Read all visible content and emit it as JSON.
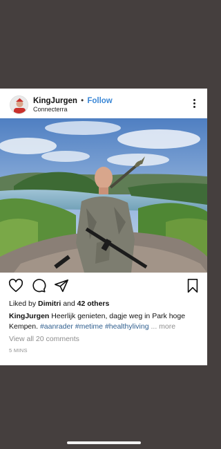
{
  "post": {
    "username": "KingJurgen",
    "separator": "•",
    "follow_label": "Follow",
    "location": "Connecterra",
    "liked_by_prefix": "Liked by",
    "liked_by_user": "Dimitri",
    "liked_by_and": "and",
    "liked_by_others": "42 others",
    "caption_user": "KingJurgen",
    "caption_text": "Heerlijk genieten, dagje weg in Park hoge Kempen.",
    "hashtags": [
      "#aanrader",
      "#metime",
      "#healthyliving"
    ],
    "more_label": "... more",
    "comments_label": "View all 20 comments",
    "timestamp": "5 MINS"
  },
  "icons": {
    "more": "more-options-icon",
    "like": "heart-icon",
    "comment": "comment-icon",
    "share": "send-icon",
    "save": "bookmark-icon"
  },
  "colors": {
    "background": "#453f3e",
    "card": "#ffffff",
    "link": "#3a87d6",
    "hashtag": "#2f5e8e",
    "muted": "#8e8e8e"
  }
}
